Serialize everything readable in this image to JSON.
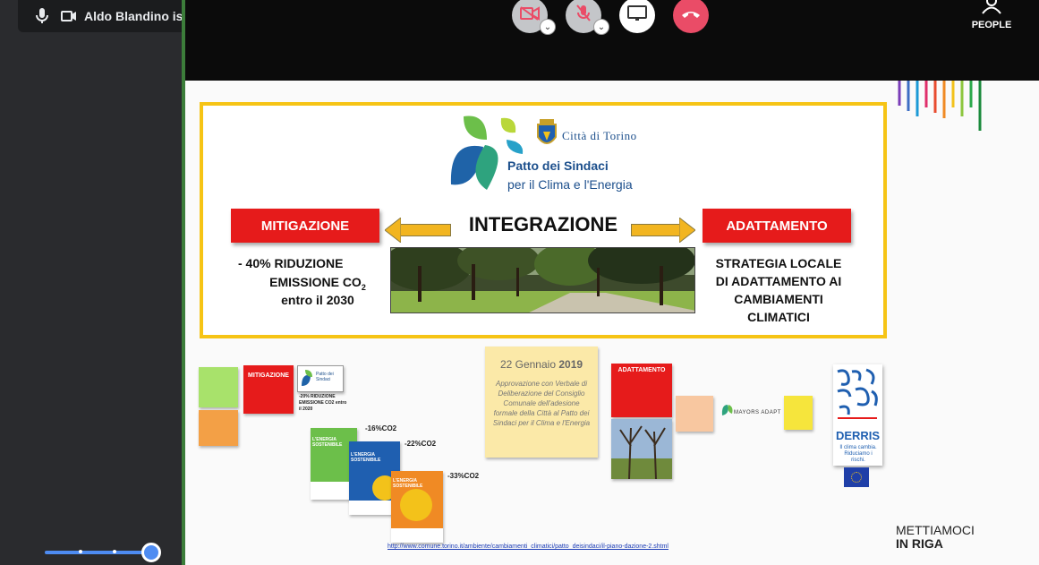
{
  "meet": {
    "talking_label": "Aldo Blandino is talking",
    "people_label": "PEOPLE",
    "icons": [
      "mic-icon",
      "camera-icon",
      "camera-off-icon",
      "mic-off-icon",
      "present-screen-icon",
      "hang-up-icon",
      "people-icon"
    ],
    "colors": {
      "muted_button": "#9aa0a6",
      "hangup": "#ea4c67",
      "accent": "#4e8cf2"
    }
  },
  "slide": {
    "logo_city": "Città di Torino",
    "logo_patto_line1": "Patto dei Sindaci",
    "logo_patto_line2": "per il Clima e l'Energia",
    "mitigazione": "MITIGAZIONE",
    "integrazione": "INTEGRAZIONE",
    "adattamento": "ADATTAMENTO",
    "mitig_text_1": "-    40% RIDUZIONE",
    "mitig_text_2": "EMISSIONE CO",
    "mitig_text_sub": "2",
    "mitig_text_3": "entro il 2030",
    "adatt_text_1": "STRATEGIA LOCALE",
    "adatt_text_2": "DI ADATTAMENTO AI",
    "adatt_text_3": "CAMBIAMENTI",
    "adatt_text_4": "CLIMATICI",
    "date_day": "22 Gennaio",
    "date_year": "2019",
    "approval_text": "Approvazione con Verbale di Deliberazione del Consiglio Comunale dell'adesione formale della Città al Patto dei Sindaci per il Clima e l'Energia",
    "small_mitigazione": "MITIGAZIONE",
    "small_adattamento": "ADATTAMENTO",
    "small_patto": "Patto dei Sindaci",
    "small_reduction": "-20% RIDUZIONE EMISSIONE CO2 entro il 2020",
    "pct_16": "-16%CO2",
    "pct_22": "-22%CO2",
    "pct_33": "-33%CO2",
    "cover1_title": "L'ENERGIA SOSTENIBILE",
    "cover2_title": "L'ENERGIA SOSTENIBILE",
    "cover3_title": "L'ENERGIA SOSTENIBILE",
    "mayors_adapt": "MAYORS ADAPT",
    "derris_title": "DERRIS",
    "derris_sub": "Il clima cambia. Riduciamo i rischi.",
    "url": "http://www.comune.torino.it/ambiente/cambiamenti_climatici/patto_deisindaci/il-piano-dazione-2.shtml",
    "footer_line1": "METTIAMOCI",
    "footer_line2": "IN RIGA"
  }
}
